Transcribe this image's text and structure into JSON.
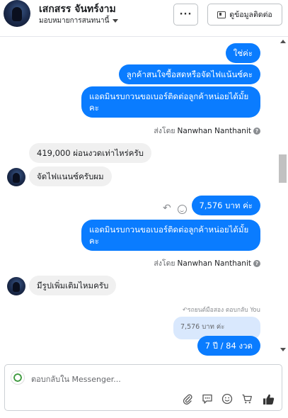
{
  "header": {
    "name": "เสกสรร จันทร์งาม",
    "assign_label": "มอบหมายการสนทนานี้",
    "more_label": "···",
    "contact_label": "ดูข้อมูลติดต่อ"
  },
  "messages": [
    {
      "from": "page",
      "text": "ใช่ค่ะ"
    },
    {
      "from": "page",
      "text": "ลูกค้าสนใจซื้อสดหรือจัดไฟแน้นซ์คะ"
    },
    {
      "from": "page",
      "text": "แอดมินรบกวนขอเบอร์ติดต่อลูกค้าหน่อยได้มั้ยคะ"
    },
    {
      "from": "customer",
      "text": "419,000 ผ่อนงวดเท่าไหร่ครับ"
    },
    {
      "from": "customer",
      "text": "จัดไฟแนนซ์ครับผม"
    },
    {
      "from": "page",
      "text": "7,576 บาท ค่ะ"
    },
    {
      "from": "page",
      "text": "แอดมินรบกวนขอเบอร์ติดต่อลูกค้าหน่อยได้มั้ยคะ"
    },
    {
      "from": "customer",
      "text": "มีรูปเพิ่มเติมไหมครับ"
    },
    {
      "from": "page",
      "text": "7 ปี / 84 งวด"
    }
  ],
  "sent_by": {
    "prefix": "ส่งโดย",
    "name": "Nanwhan Nanthanit"
  },
  "reply_context": {
    "label": "↶รถยนต์มือสอง ตอบกลับ You",
    "quoted_text": "7,576 บาท ค่ะ"
  },
  "composer": {
    "placeholder": "ตอบกลับใน Messenger..."
  },
  "icons": {
    "more": "more-icon",
    "contact": "contact-card-icon",
    "attach": "paperclip-icon",
    "saved_replies": "chat-bubble-icon",
    "emoji": "emoji-icon",
    "cart": "cart-icon",
    "like": "thumbs-up-icon"
  },
  "colors": {
    "outgoing_bubble": "#0a7cff",
    "incoming_bubble": "#f0f0f0",
    "quoted_bubble": "#d9e8fd"
  }
}
